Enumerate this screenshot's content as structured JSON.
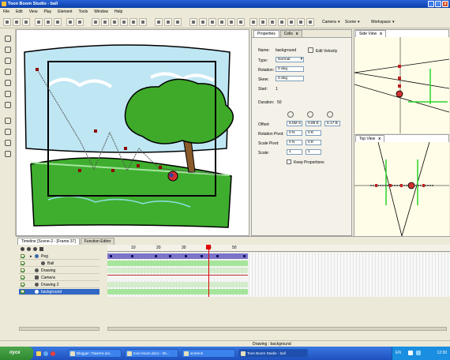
{
  "window": {
    "title": "Toon Boom Studio - ball"
  },
  "menu": [
    "File",
    "Edit",
    "View",
    "Play",
    "Element",
    "Tools",
    "Window",
    "Help"
  ],
  "toolbar": {
    "camera_label": "Camera",
    "scene_label": "Scene",
    "workspace_label": "Workspace"
  },
  "properties": {
    "tabs": [
      "Properties",
      "Cells"
    ],
    "name_label": "Name:",
    "name_value": "background",
    "edit_velocity_label": "Edit Velocity",
    "type_label": "Type:",
    "type_value": "Normal",
    "rotation_label": "Rotation:",
    "rotation_value": "0 deg",
    "skew_label": "Skew:",
    "skew_value": "0 deg",
    "start_label": "Start:",
    "start_value": "1",
    "duration_label": "Duration:",
    "duration_value": "50",
    "offset_label": "Offset:",
    "offset_x": "6.5M S",
    "offset_y": "0.89 E",
    "offset_z": "5.17 B",
    "rotation_pivot_label": "Rotation Pivot:",
    "rot_pivot_x": "0 N",
    "rot_pivot_y": "0 E",
    "scale_pivot_label": "Scale Pivot:",
    "scale_pivot_x": "0 N",
    "scale_pivot_y": "0 E",
    "scale_label": "Scale:",
    "scale_x": "1",
    "scale_y": "1",
    "keep_proportions_label": "Keep Proportions"
  },
  "side_view": {
    "title": "Side View"
  },
  "top_view": {
    "title": "Top View"
  },
  "timeline": {
    "tabs": [
      "Timeline [Scene-2 - [Frame 37]",
      "Function Editor"
    ],
    "ruler": [
      "10",
      "20",
      "30",
      "40",
      "50"
    ],
    "layers": [
      {
        "name": "Peg",
        "selected": false
      },
      {
        "name": "Ball",
        "selected": false
      },
      {
        "name": "Drawing",
        "selected": false
      },
      {
        "name": "Camera",
        "selected": false
      },
      {
        "name": "Drawing 2",
        "selected": false
      },
      {
        "name": "background",
        "selected": true
      }
    ]
  },
  "status": {
    "text": "Drawing : background"
  },
  "taskbar": {
    "start_label": "пуск",
    "tasks": [
      "Blogger: Памяти ani...",
      "toon boom.docx - Mi...",
      "screens",
      "Toon Boom Studio - ball"
    ],
    "lang": "EN",
    "clock": "12:30"
  },
  "colors": {
    "accent": "#316ac5",
    "tree": "#3faa2a",
    "sky": "#bfe6f3",
    "ground": "#3fae2f",
    "frame_marker": "#e00000"
  }
}
